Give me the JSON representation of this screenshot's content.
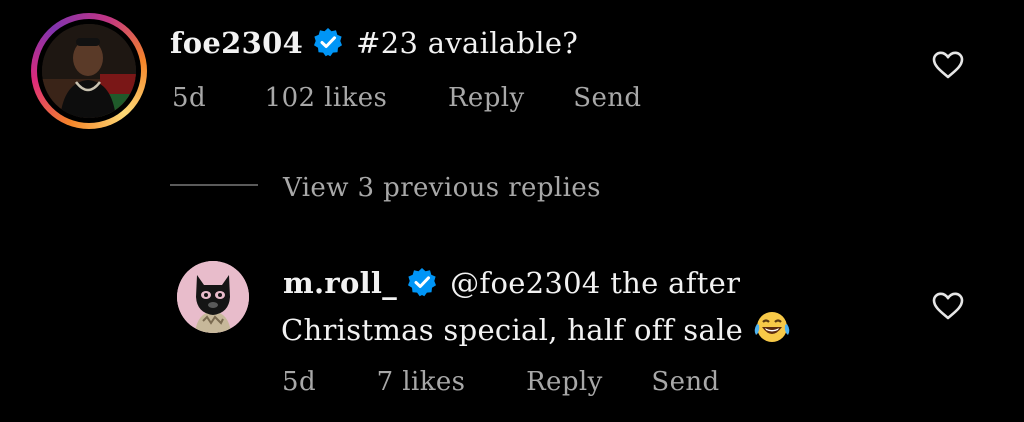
{
  "comments": [
    {
      "username": "foe2304",
      "verified": true,
      "text": "#23 available?",
      "time": "5d",
      "likes": "102 likes",
      "reply_label": "Reply",
      "send_label": "Send",
      "avatar_has_story_ring": true
    },
    {
      "username": "m.roll_",
      "verified": true,
      "mention": "@foe2304",
      "text_line1": " the after",
      "text_line2": "Christmas special, half off sale",
      "emoji": "face-with-tears-of-joy",
      "time": "5d",
      "likes": "7 likes",
      "reply_label": "Reply",
      "send_label": "Send"
    }
  ],
  "thread": {
    "view_replies_label": "View 3 previous replies"
  },
  "colors": {
    "background": "#000000",
    "text": "#f2f2f2",
    "meta": "#a8a8a8",
    "verified_blue": "#0095f6",
    "divider": "#5b5b5b"
  },
  "icons": [
    "verified-badge-icon",
    "heart-icon",
    "laughing-emoji-icon"
  ]
}
